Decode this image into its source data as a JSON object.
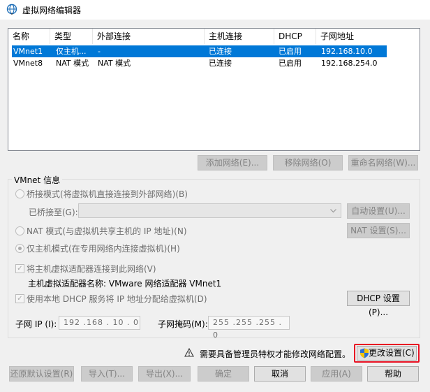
{
  "window": {
    "title": "虚拟网络编辑器"
  },
  "table": {
    "headers": [
      "名称",
      "类型",
      "外部连接",
      "主机连接",
      "DHCP",
      "子网地址"
    ],
    "rows": [
      {
        "name": "VMnet1",
        "type": "仅主机...",
        "external": "-",
        "host": "已连接",
        "dhcp": "已启用",
        "subnet": "192.168.10.0",
        "selected": true
      },
      {
        "name": "VMnet8",
        "type": "NAT 模式",
        "external": "NAT 模式",
        "host": "已连接",
        "dhcp": "已启用",
        "subnet": "192.168.254.0",
        "selected": false
      }
    ]
  },
  "network_buttons": {
    "add": "添加网络(E)...",
    "remove": "移除网络(O)",
    "rename": "重命名网络(W)..."
  },
  "vmnet_info": {
    "title": "VMnet 信息",
    "bridge_mode": "桥接模式(将虚拟机直接连接到外部网络)(B)",
    "bridged_to_label": "已桥接至(G):",
    "auto_settings": "自动设置(U)...",
    "nat_mode": "NAT 模式(与虚拟机共享主机的 IP 地址)(N)",
    "nat_settings": "NAT 设置(S)...",
    "host_only_mode": "仅主机模式(在专用网络内连接虚拟机)(H)",
    "connect_adapter": "将主机虚拟适配器连接到此网络(V)",
    "adapter_name": "主机虚拟适配器名称: VMware 网络适配器 VMnet1",
    "use_dhcp": "使用本地 DHCP 服务将 IP 地址分配给虚拟机(D)",
    "dhcp_settings": "DHCP 设置(P)...",
    "subnet_ip_label": "子网 IP (I):",
    "subnet_ip": "192 .168 . 10 . 0",
    "subnet_mask_label": "子网掩码(M):",
    "subnet_mask": "255 .255 .255 . 0"
  },
  "admin_notice": {
    "text": "需要具备管理员特权才能修改网络配置。",
    "change_settings": "更改设置(C)"
  },
  "footer": {
    "restore": "还原默认设置(R)",
    "import": "导入(T)...",
    "export": "导出(X)...",
    "ok": "确定",
    "cancel": "取消",
    "apply": "应用(A)",
    "help": "帮助"
  },
  "colors": {
    "selection": "#0078d7",
    "highlight_border": "#e81123",
    "shield_blue": "#2b6fd6",
    "shield_yellow": "#f5c400"
  }
}
